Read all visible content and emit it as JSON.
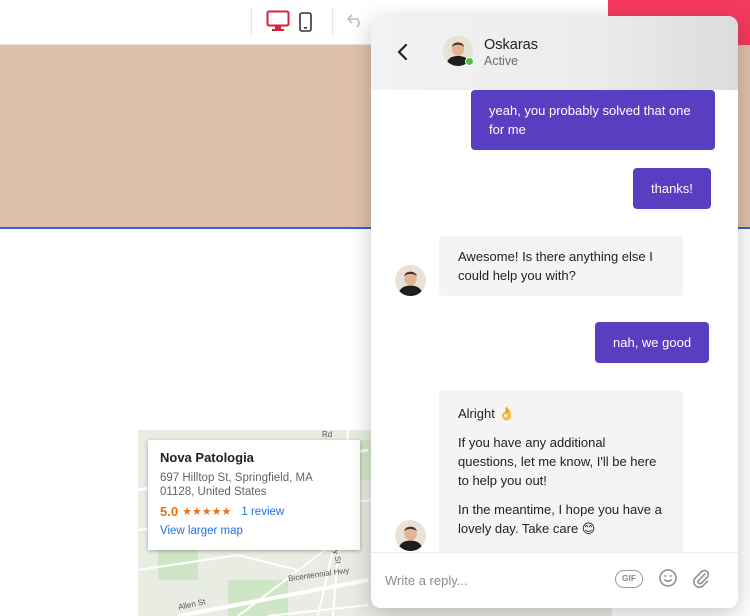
{
  "chat": {
    "agent_name": "Oskaras",
    "agent_status": "Active",
    "messages": [
      {
        "from": "user",
        "text": "yeah, you probably solved that one for me"
      },
      {
        "from": "user",
        "text": "thanks!"
      },
      {
        "from": "agent",
        "text": "Awesome! Is there anything else I could help you with?"
      },
      {
        "from": "user",
        "text": "nah, we good"
      },
      {
        "from": "agent",
        "paragraphs": [
          "Alright 👌",
          "If you have any additional questions, let me know, I'll be here to help you out!",
          "In the meantime, I hope you have a lovely day. Take care 😊"
        ]
      }
    ],
    "composer": {
      "placeholder": "Write a reply...",
      "gif_label": "GIF"
    }
  },
  "map": {
    "place_name": "Nova Patologia",
    "address": "697 Hilltop St, Springfield, MA 01128, United States",
    "rating": "5.0",
    "stars": "★★★★★",
    "reviews": "1 review",
    "view_link": "View larger map",
    "street_labels": [
      "Bicentennial Hwy",
      "Allen St",
      "Cooley St",
      "Rd"
    ]
  },
  "colors": {
    "user_bubble": "#5a3ec2",
    "agent_bubble": "#f4f4f4",
    "online": "#4fbf4a",
    "hero": "#dfc0ac",
    "accent_red": "#f43a5e"
  },
  "icons": {
    "header": [
      "desktop-icon",
      "mobile-icon",
      "undo-icon"
    ],
    "chat": [
      "back-arrow-icon",
      "emoji-icon",
      "paperclip-icon"
    ]
  }
}
